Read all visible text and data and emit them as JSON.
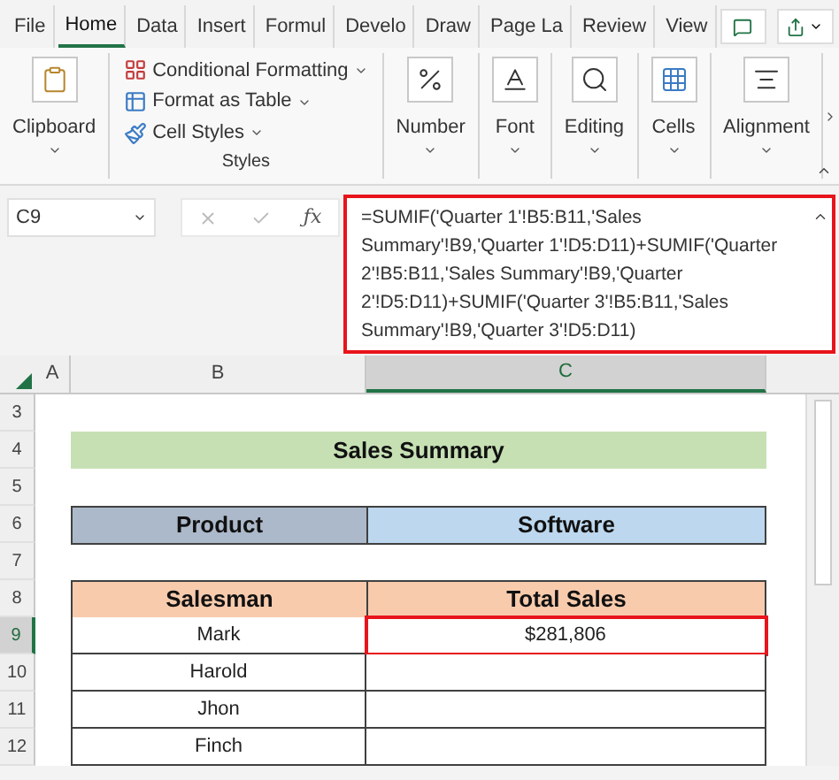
{
  "ribbon_tabs": [
    {
      "label": "File",
      "selected": false
    },
    {
      "label": "Home",
      "selected": true
    },
    {
      "label": "Data",
      "selected": false
    },
    {
      "label": "Insert",
      "selected": false
    },
    {
      "label": "Formul",
      "selected": false
    },
    {
      "label": "Develo",
      "selected": false
    },
    {
      "label": "Draw",
      "selected": false
    },
    {
      "label": "Page La",
      "selected": false
    },
    {
      "label": "Review",
      "selected": false
    },
    {
      "label": "View",
      "selected": false
    }
  ],
  "ribbon_groups": [
    {
      "kind": "big",
      "label": "Clipboard"
    },
    {
      "kind": "list",
      "label": "Styles",
      "commands": [
        {
          "label": "Conditional Formatting"
        },
        {
          "label": "Format as Table"
        },
        {
          "label": "Cell Styles"
        }
      ]
    },
    {
      "kind": "big",
      "label": "Number"
    },
    {
      "kind": "big",
      "label": "Font"
    },
    {
      "kind": "big",
      "label": "Editing"
    },
    {
      "kind": "big",
      "label": "Cells"
    },
    {
      "kind": "big",
      "label": "Alignment"
    }
  ],
  "name_box": "C9",
  "function_label": "ƒx",
  "formula": "=SUMIF('Quarter 1'!B5:B11,'Sales Summary'!B9,'Quarter 1'!D5:D11)+SUMIF('Quarter 2'!B5:B11,'Sales Summary'!B9,'Quarter 2'!D5:D11)+SUMIF('Quarter 3'!B5:B11,'Sales Summary'!B9,'Quarter 3'!D5:D11)",
  "columns": [
    {
      "label": "A",
      "selected": false
    },
    {
      "label": "B",
      "selected": false
    },
    {
      "label": "C",
      "selected": true
    }
  ],
  "rows": [
    {
      "number": "3",
      "selected": false,
      "kind": "blank"
    },
    {
      "number": "4",
      "selected": false,
      "kind": "title",
      "text": "Sales Summary",
      "color": "#c6e0b4"
    },
    {
      "number": "5",
      "selected": false,
      "kind": "blank"
    },
    {
      "number": "6",
      "selected": false,
      "kind": "pair",
      "cells": [
        {
          "text": "Product",
          "color": "#acb9ca"
        },
        {
          "text": "Software",
          "color": "#bdd7ee"
        }
      ]
    },
    {
      "number": "7",
      "selected": false,
      "kind": "blank"
    },
    {
      "number": "8",
      "selected": false,
      "kind": "header",
      "cells": [
        {
          "text": "Salesman",
          "color": "#f8cbad"
        },
        {
          "text": "Total Sales",
          "color": "#f8cbad"
        }
      ]
    },
    {
      "number": "9",
      "selected": true,
      "kind": "data",
      "cells": [
        {
          "text": "Mark",
          "selected": false
        },
        {
          "text": "$281,806",
          "selected": true
        }
      ]
    },
    {
      "number": "10",
      "selected": false,
      "kind": "data",
      "cells": [
        {
          "text": "Harold",
          "selected": false
        },
        {
          "text": "",
          "selected": false
        }
      ]
    },
    {
      "number": "11",
      "selected": false,
      "kind": "data",
      "cells": [
        {
          "text": "Jhon",
          "selected": false
        },
        {
          "text": "",
          "selected": false
        }
      ]
    },
    {
      "number": "12",
      "selected": false,
      "kind": "data",
      "cells": [
        {
          "text": "Finch",
          "selected": false
        },
        {
          "text": "",
          "selected": false
        }
      ]
    }
  ]
}
